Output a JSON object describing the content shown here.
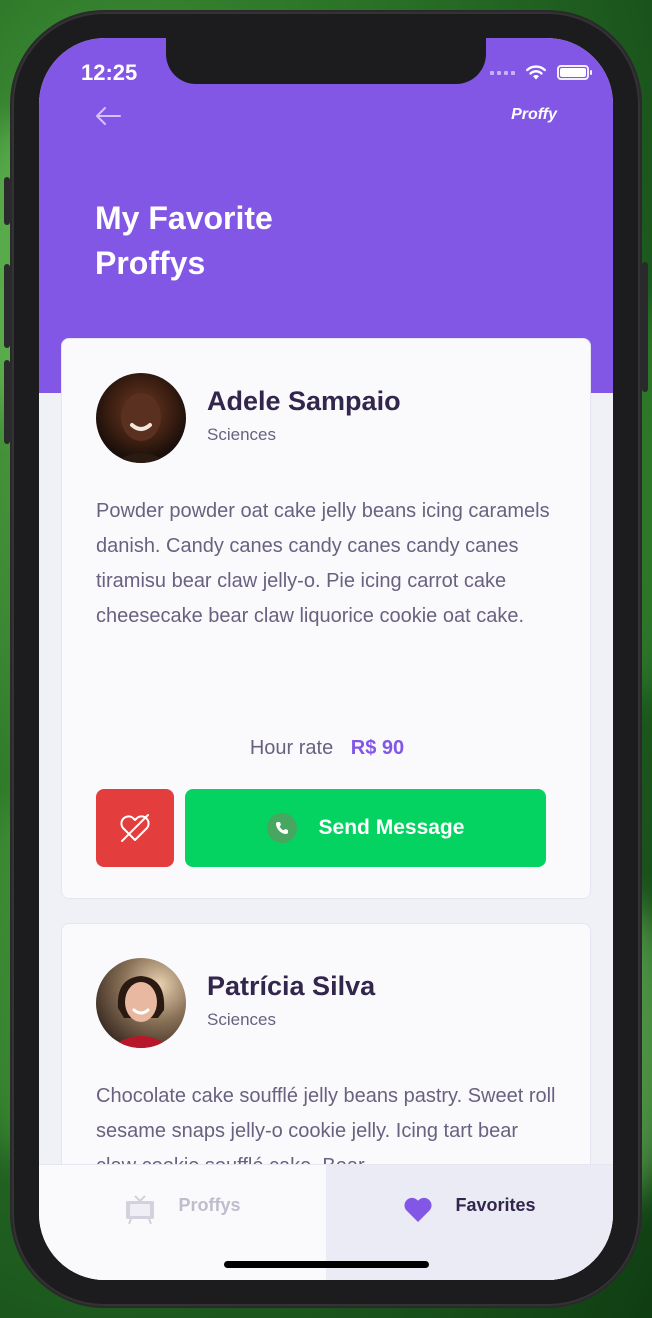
{
  "status_bar": {
    "time": "12:25"
  },
  "header": {
    "brand": "Proffy",
    "title_line1": "My Favorite",
    "title_line2": "Proffys"
  },
  "teachers": [
    {
      "name": "Adele Sampaio",
      "subject": "Sciences",
      "bio": "Powder powder oat cake jelly beans icing caramels danish. Candy canes candy canes candy canes tiramisu bear claw jelly-o. Pie icing carrot cake cheesecake bear claw liquorice cookie oat cake.",
      "price_label": "Hour rate",
      "price": "R$ 90",
      "message_label": "Send Message"
    },
    {
      "name": "Patrícia Silva",
      "subject": "Sciences",
      "bio": "Chocolate cake soufflé jelly beans pastry. Sweet roll sesame snaps jelly-o cookie jelly. Icing tart bear claw cookie soufflé cake. Bear"
    }
  ],
  "tabs": [
    {
      "label": "Proffys",
      "icon": "tv-icon",
      "active": false
    },
    {
      "label": "Favorites",
      "icon": "heart-icon",
      "active": true
    }
  ],
  "colors": {
    "primary": "#8257e5",
    "danger": "#e33d3d",
    "success": "#04d361",
    "text_title": "#32264d",
    "text_body": "#6a6180"
  }
}
